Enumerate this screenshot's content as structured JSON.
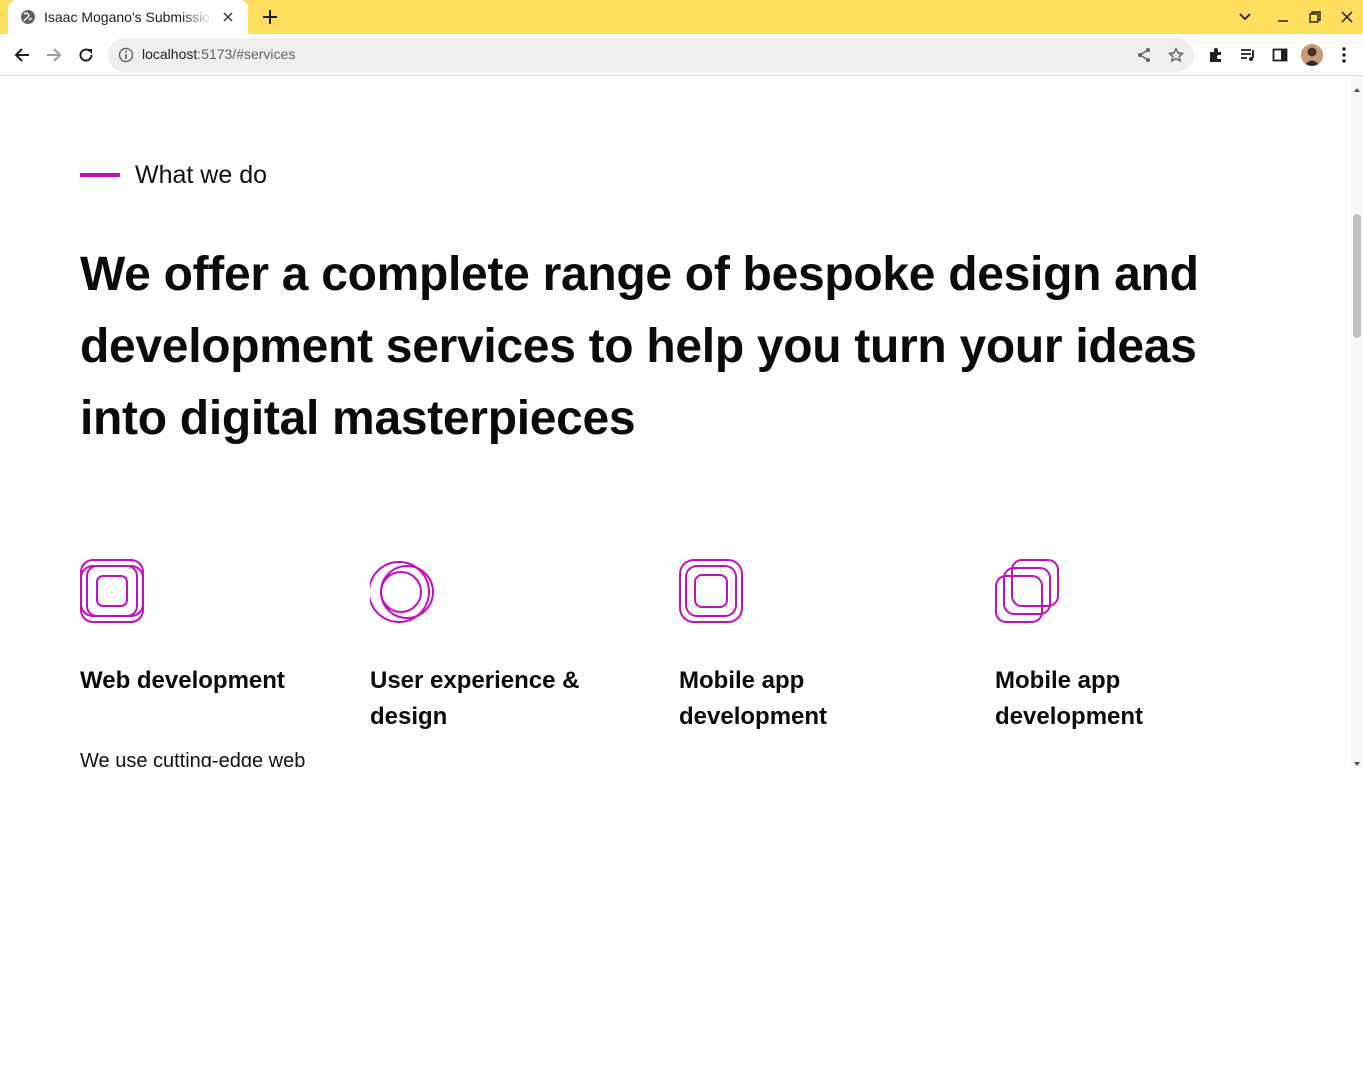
{
  "browser": {
    "tab_title": "Isaac Mogano's Submission",
    "url_host": "localhost",
    "url_path": ":5173/#services"
  },
  "section": {
    "eyebrow": "What we do",
    "headline": "We offer a complete range of bespoke design and development services to help you turn your ideas into digital masterpieces",
    "accent_color": "#c20fbe"
  },
  "services": [
    {
      "icon": "nested-squares-icon",
      "title": "Web development",
      "description": "We use cutting-edge web"
    },
    {
      "icon": "overlapping-circles-icon",
      "title": "User experience & design",
      "description": ""
    },
    {
      "icon": "concentric-squares-icon",
      "title": "Mobile app development",
      "description": ""
    },
    {
      "icon": "stacked-squares-icon",
      "title": "Mobile app development",
      "description": ""
    }
  ]
}
